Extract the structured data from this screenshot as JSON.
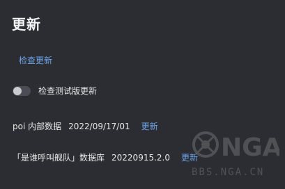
{
  "page": {
    "title": "更新",
    "check_update_label": "检查更新",
    "beta_toggle": {
      "label": "检查测试版更新",
      "state": "off"
    },
    "poi_data": {
      "name": "poi 内部数据",
      "version": "2022/09/17/01",
      "update_label": "更新"
    },
    "who_called_db": {
      "name": "「是谁呼叫舰队」数据库",
      "version": "20220915.2.0",
      "update_label": "更新"
    }
  },
  "watermark": {
    "logo_text": "NGA",
    "url_text": "BBS.NGA.CN"
  },
  "colors": {
    "background": "#2b2d33",
    "link": "#6ea3e6",
    "text": "#e8e8e8"
  }
}
